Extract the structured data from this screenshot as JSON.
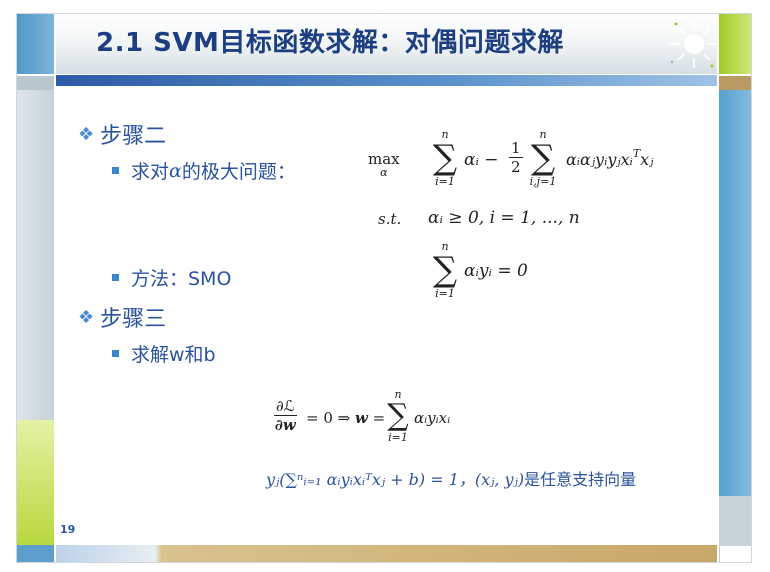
{
  "slide": {
    "title": "2.1 SVM目标函数求解：对偶问题求解",
    "page_number": "19"
  },
  "bullets": {
    "step2": "步骤二",
    "step2_item_prefix": "求对",
    "step2_item_alpha": "α",
    "step2_item_suffix": "的极大问题：",
    "method": "方法：SMO",
    "step3": "步骤三",
    "step3_item": "求解w和b"
  },
  "formulas": {
    "max_op": "max",
    "max_sub": "α",
    "sum_upper": "n",
    "sum_lower_i": "i=1",
    "sum_lower_ij": "i,j=1",
    "term1": "αᵢ − ",
    "half_num": "1",
    "half_den": "2",
    "term2": "αᵢαⱼyᵢyⱼxᵢ",
    "term2_sup": "T",
    "term2_tail": "xⱼ",
    "st_label": "s.t.",
    "constraint1": "αᵢ ≥ 0, i = 1, ..., n",
    "constraint2_expr": "αᵢyᵢ = 0",
    "grad_num": "∂ℒ",
    "grad_den": "∂w",
    "grad_mid": "= 0 ⇒ ",
    "grad_w": "w",
    "grad_eq": " = ",
    "grad_term": "αᵢyᵢxᵢ",
    "support_eq": "yⱼ(∑ⁿᵢ₌₁ αᵢyᵢxᵢᵀxⱼ + b) = 1，(xⱼ, yⱼ)",
    "support_text": "是任意支持向量"
  },
  "colors": {
    "title": "#1d3f82",
    "bullet_text": "#2b52a0",
    "accent_blue": "#4f98c9",
    "accent_green": "#9fcb2a",
    "accent_tan": "#c9a768"
  }
}
